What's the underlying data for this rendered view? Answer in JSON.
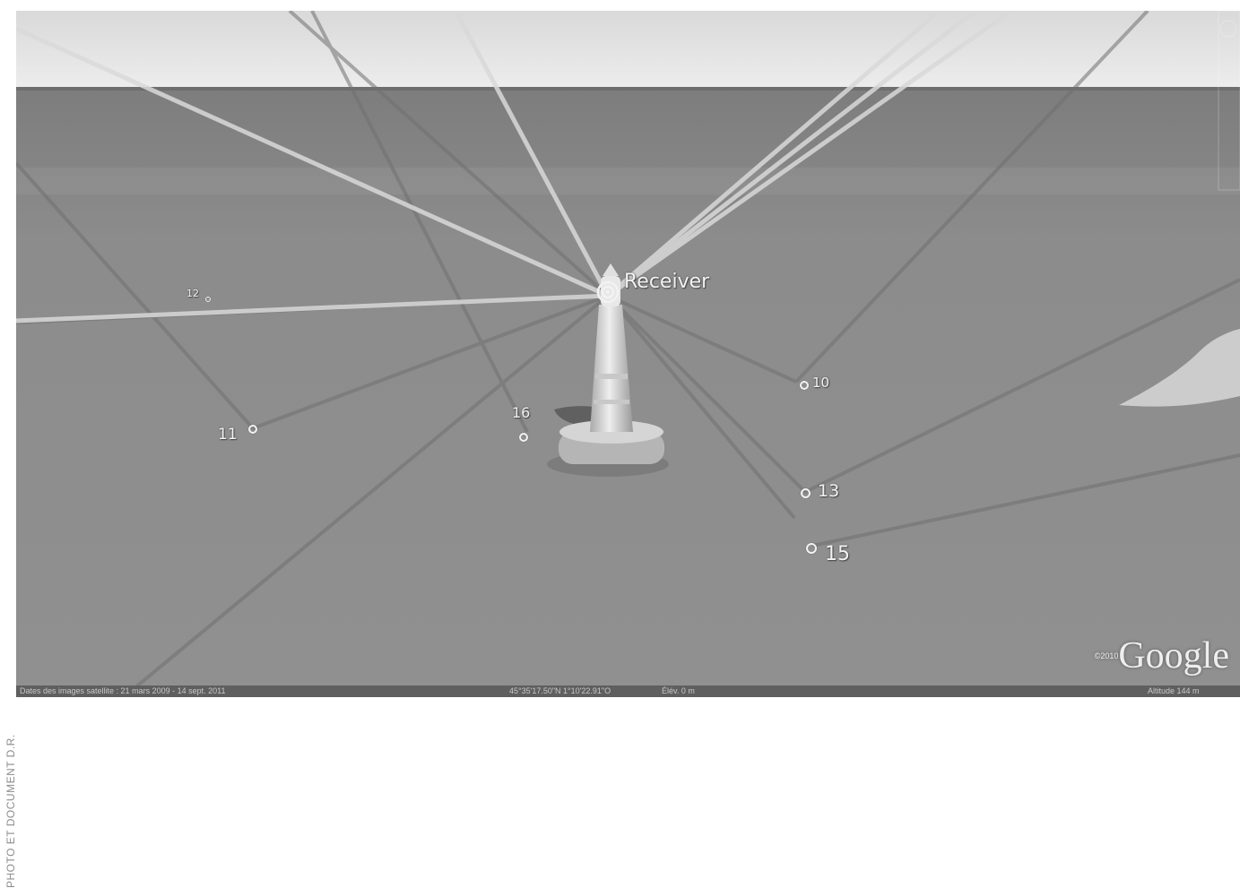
{
  "side_credit": "PHOTO ET DOCUMENT D.R.",
  "receiver": {
    "label": "Receiver"
  },
  "points": [
    {
      "id": "10",
      "label": "10"
    },
    {
      "id": "11",
      "label": "11"
    },
    {
      "id": "12",
      "label": "12"
    },
    {
      "id": "13",
      "label": "13"
    },
    {
      "id": "15",
      "label": "15"
    },
    {
      "id": "16",
      "label": "16"
    }
  ],
  "watermark": {
    "copyright": "©2010",
    "word": "Google"
  },
  "status": {
    "imagery_dates": "Dates des images satellite : 21 mars 2009 - 14 sept. 2011",
    "coordinates": "45°35'17.50\"N    1°10'22.91\"O",
    "elevation": "Élév.   0 m",
    "altitude": "Altitude     144 m"
  },
  "colors": {
    "sky": "#e6e6e6",
    "sea": "#8a8a8a",
    "ray": "#d8d8d8",
    "ray_dark": "#6f6f6f"
  }
}
